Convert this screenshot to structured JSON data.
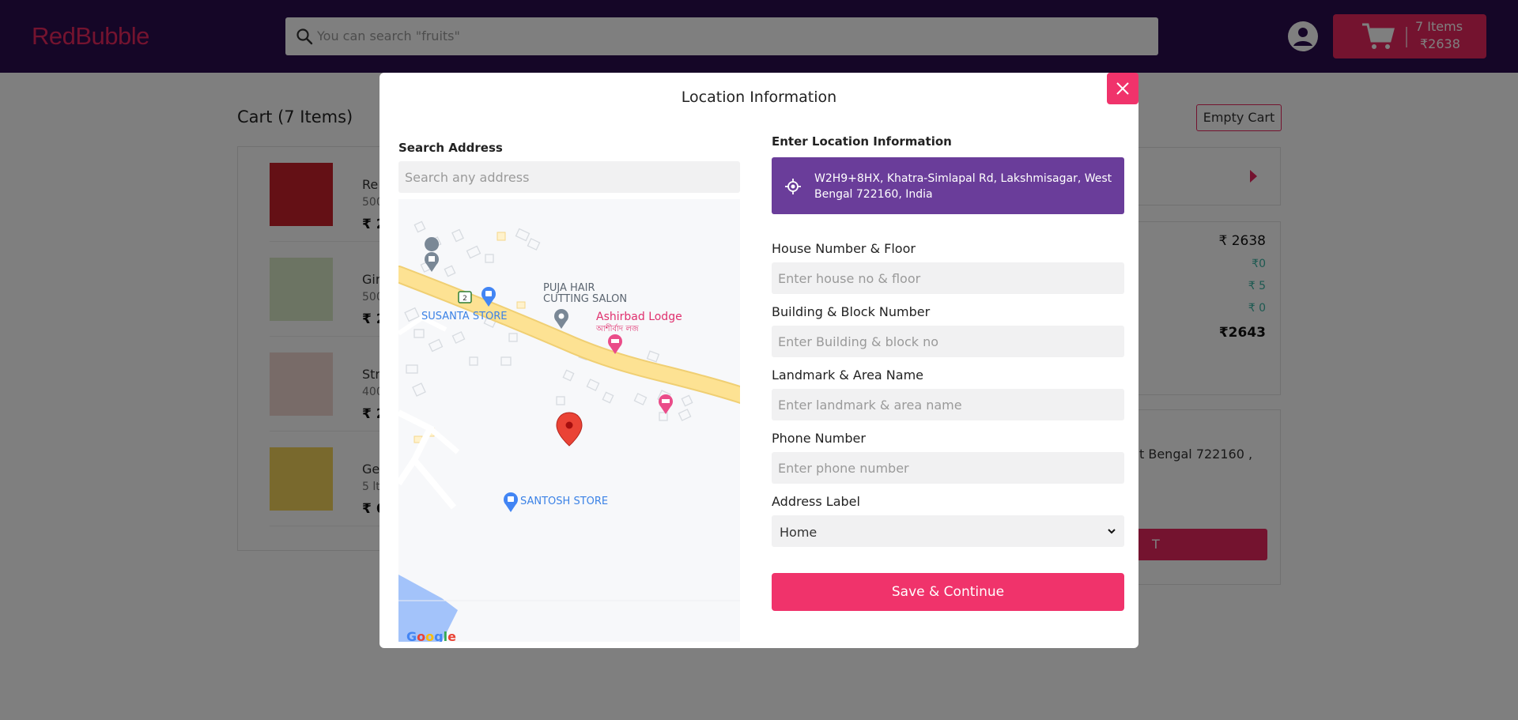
{
  "header": {
    "logo": "RedBubble",
    "search_placeholder": "You can search \"fruits\"",
    "cart_items": "7 Items",
    "cart_amount": "₹2638"
  },
  "page": {
    "title": "Cart (7 Items)",
    "empty_cart": "Empty Cart",
    "items": [
      {
        "name": "Re",
        "qty": "500",
        "price": "₹ 2"
      },
      {
        "name": "Gir",
        "qty": "500",
        "price": "₹ 2"
      },
      {
        "name": "Str",
        "qty": "400",
        "price": "₹ 2"
      },
      {
        "name": "Ge",
        "qty": "5 ltr",
        "price": "₹ 6"
      }
    ],
    "bill": {
      "total": "₹ 2638",
      "line1": "₹0",
      "line2": "₹ 5",
      "line3": "₹ 0",
      "grand": "₹2643"
    },
    "address_partial": "t Bengal 722160 ,",
    "checkout_partial": "T"
  },
  "modal": {
    "title": "Location Information",
    "search_address_label": "Search Address",
    "search_address_placeholder": "Search any address",
    "enter_location_label": "Enter Location Information",
    "current_location": "W2H9+8HX, Khatra-Simlapal Rd, Lakshmisagar, West Bengal 722160, India",
    "house_label": "House Number & Floor",
    "house_placeholder": "Enter house no & floor",
    "building_label": "Building & Block Number",
    "building_placeholder": "Enter Building & block no",
    "landmark_label": "Landmark & Area Name",
    "landmark_placeholder": "Enter landmark & area name",
    "phone_label": "Phone Number",
    "phone_placeholder": "Enter phone number",
    "address_label": "Address Label",
    "address_label_value": "Home",
    "save_button": "Save & Continue"
  },
  "map": {
    "places": {
      "susanta": "SUSANTA STORE",
      "puja": "PUJA HAIR\nCUTTING SALON",
      "ashirbad": "Ashirbad Lodge",
      "ashirbad_local": "আশীর্বাদ লজ",
      "santosh": "SANTOSH STORE"
    },
    "route_number": "2",
    "google": "Google"
  },
  "colors": {
    "accent": "#f0336b",
    "header_bg": "#2a0c4e",
    "location_box": "#6a3d9a"
  }
}
